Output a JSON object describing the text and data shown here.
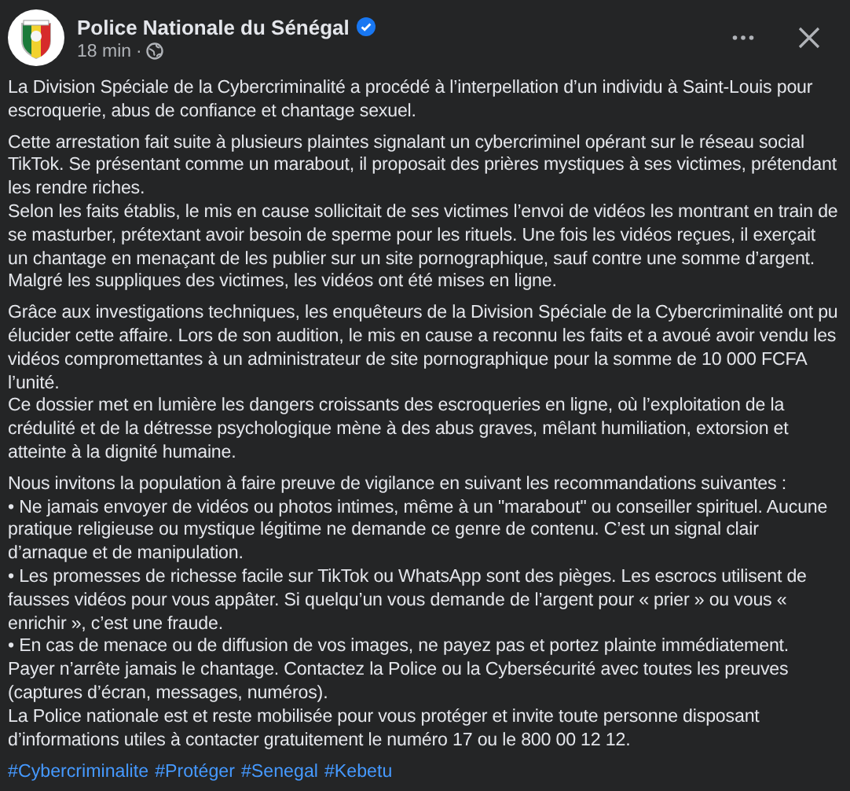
{
  "post": {
    "author": "Police Nationale du Sénégal",
    "verified": true,
    "time": "18 min",
    "separator": "·"
  },
  "paragraphs": [
    {
      "lines": [
        "La Division Spéciale de la Cybercriminalité a procédé à l’interpellation d’un individu à Saint-Louis pour escroquerie, abus de confiance et chantage sexuel."
      ]
    },
    {
      "lines": [
        "Cette arrestation fait suite à plusieurs plaintes signalant un cybercriminel opérant sur le réseau social TikTok. Se présentant comme un marabout, il proposait des prières mystiques à ses victimes, prétendant les rendre riches.",
        "Selon les faits établis, le mis en cause sollicitait de ses victimes l’envoi de vidéos les montrant en train de se masturber, prétextant avoir besoin de sperme pour les rituels. Une fois les vidéos reçues, il exerçait un chantage en menaçant de les publier sur un site pornographique, sauf contre une somme d’argent.",
        "Malgré les suppliques des victimes, les vidéos ont été mises en ligne."
      ]
    },
    {
      "lines": [
        "Grâce aux investigations techniques, les enquêteurs de la Division Spéciale de la Cybercriminalité ont pu élucider cette affaire. Lors de son audition, le mis en cause a reconnu les faits et a avoué avoir vendu les vidéos compromettantes à un administrateur de site pornographique pour la somme de 10 000 FCFA l’unité.",
        "Ce dossier met en lumière les dangers croissants des escroqueries en ligne, où l’exploitation de la crédulité et de la détresse psychologique mène à des abus graves, mêlant humiliation, extorsion et atteinte à la dignité humaine."
      ]
    },
    {
      "lines": [
        "Nous invitons la population à faire preuve de vigilance en suivant les recommandations suivantes :",
        "• Ne jamais envoyer de vidéos ou photos intimes, même à un \"marabout\" ou conseiller spirituel. Aucune pratique religieuse ou mystique légitime ne demande ce genre de contenu. C’est un signal clair d’arnaque et de manipulation.",
        "• Les promesses de richesse facile sur TikTok ou WhatsApp sont des pièges. Les escrocs utilisent de fausses vidéos pour vous appâter. Si quelqu’un vous demande de l’argent pour « prier » ou vous « enrichir », c’est une fraude.",
        "• En cas de menace ou de diffusion de vos images, ne payez pas et portez plainte immédiatement. Payer n’arrête jamais le chantage. Contactez la Police ou la Cybersécurité avec toutes les preuves (captures d’écran, messages, numéros).",
        "La Police nationale est et reste mobilisée pour vous protéger et invite toute personne disposant d’informations utiles à contacter gratuitement le numéro 17 ou le 800 00 12 12."
      ]
    }
  ],
  "hashtags": [
    "#Cybercriminalite",
    "#Protéger",
    "#Senegal",
    "#Kebetu"
  ]
}
